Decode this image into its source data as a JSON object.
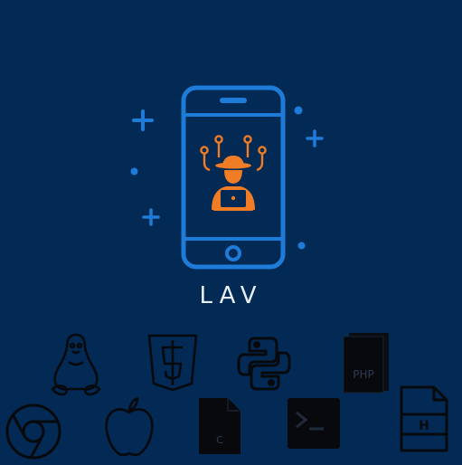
{
  "logo": {
    "title": "LAV",
    "hero_icon": "hacker-in-phone-icon"
  },
  "colors": {
    "background": "#022a55",
    "accent_blue": "#1f7bd8",
    "accent_orange": "#f07c25",
    "title_text": "#e9eef5",
    "icon_dark": "#07090d"
  },
  "tech_icons": {
    "row1": [
      "linux-tux-icon",
      "html5-icon",
      "python-icon",
      "php-file-icon"
    ],
    "row2": [
      "chrome-icon",
      "apple-icon",
      "c-file-icon",
      "terminal-icon",
      "h-file-icon"
    ],
    "labels": {
      "php": "PHP",
      "c": "C",
      "h": "H"
    }
  },
  "decorations": [
    "plus-icon",
    "plus-icon",
    "plus-icon",
    "dot-icon",
    "dot-icon",
    "dot-icon"
  ]
}
